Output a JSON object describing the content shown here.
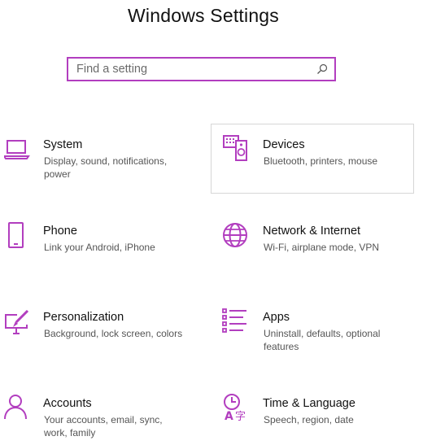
{
  "window": {
    "title": "Windows Settings"
  },
  "search": {
    "placeholder": "Find a setting",
    "value": ""
  },
  "accent_color": "#b23ebf",
  "categories": [
    {
      "name": "System",
      "description": "Display, sound, notifications, power",
      "icon": "laptop-icon"
    },
    {
      "name": "Devices",
      "description": "Bluetooth, printers, mouse",
      "icon": "keyboard-speaker-icon"
    },
    {
      "name": "Phone",
      "description": "Link your Android, iPhone",
      "icon": "phone-icon"
    },
    {
      "name": "Network & Internet",
      "description": "Wi-Fi, airplane mode, VPN",
      "icon": "globe-icon"
    },
    {
      "name": "Personalization",
      "description": "Background, lock screen, colors",
      "icon": "paint-brush-icon"
    },
    {
      "name": "Apps",
      "description": "Uninstall, defaults, optional features",
      "icon": "apps-list-icon"
    },
    {
      "name": "Accounts",
      "description": "Your accounts, email, sync, work, family",
      "icon": "person-icon"
    },
    {
      "name": "Time & Language",
      "description": "Speech, region, date",
      "icon": "time-language-icon"
    }
  ]
}
